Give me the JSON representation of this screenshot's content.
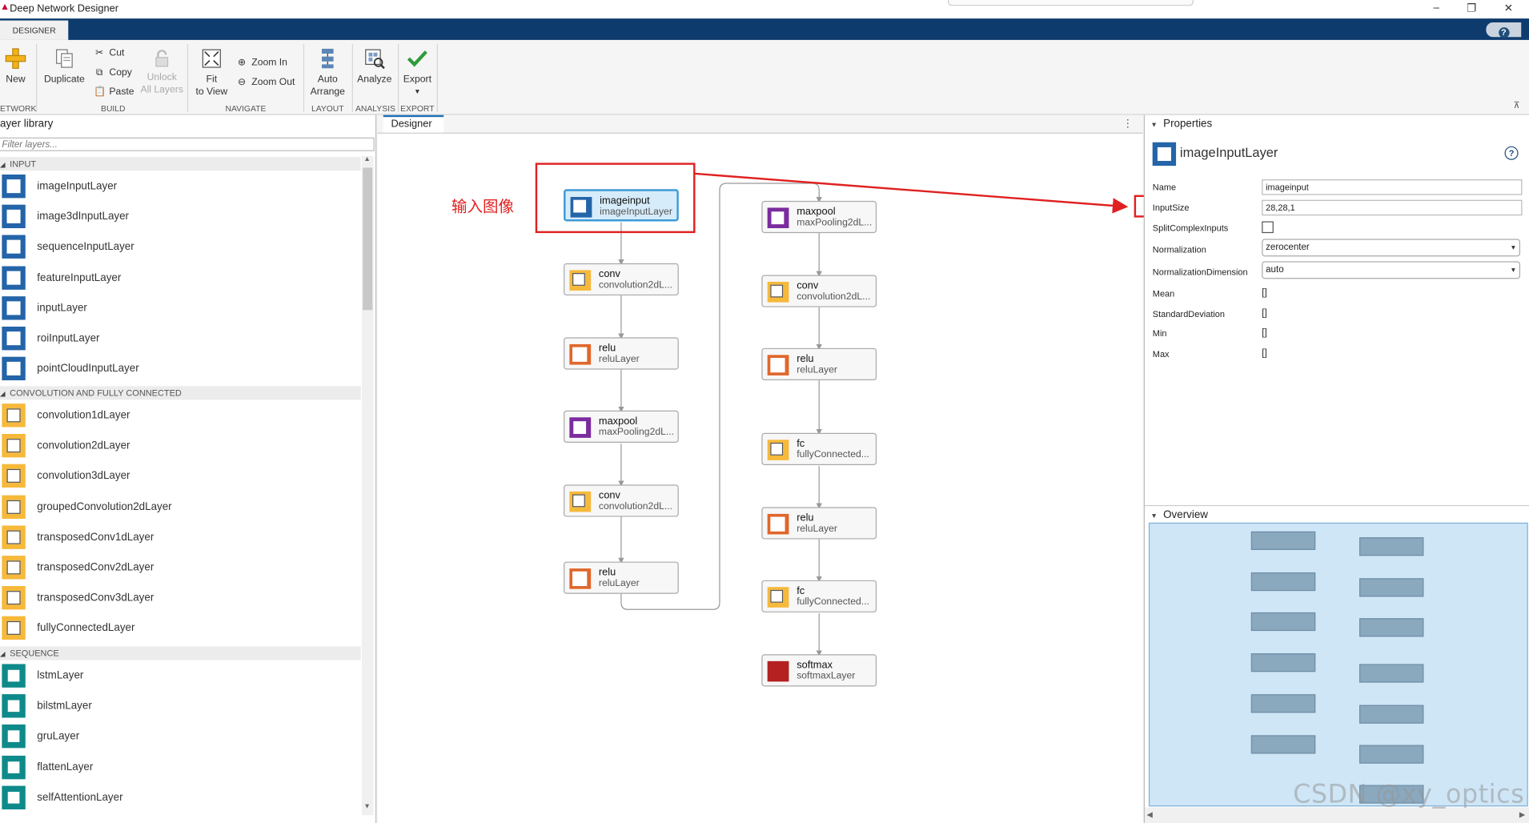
{
  "window": {
    "title": "Deep Network Designer",
    "min_glyph": "–",
    "max_glyph": "❐",
    "close_glyph": "✕"
  },
  "ribbon": {
    "tab": "DESIGNER",
    "help_glyph": "?"
  },
  "toolstrip": {
    "new_label": "New",
    "duplicate_label": "Duplicate",
    "cut_label": "Cut",
    "copy_label": "Copy",
    "paste_label": "Paste",
    "unlock_label": "Unlock",
    "unlock_label2": "All Layers",
    "fit_label": "Fit",
    "fit_label2": "to View",
    "zoom_in_label": "Zoom In",
    "zoom_out_label": "Zoom Out",
    "auto_label": "Auto",
    "auto_label2": "Arrange",
    "analyze_label": "Analyze",
    "export_label": "Export",
    "groups": {
      "network": "ETWORK",
      "build": "BUILD",
      "navigate": "NAVIGATE",
      "layout": "LAYOUT",
      "analysis": "ANALYSIS",
      "export": "EXPORT"
    }
  },
  "library": {
    "header": "ayer library",
    "filter_placeholder": "Filter layers...",
    "sections": {
      "input": "INPUT",
      "conv": "CONVOLUTION AND FULLY CONNECTED",
      "sequence": "SEQUENCE"
    },
    "input_items": [
      "imageInputLayer",
      "image3dInputLayer",
      "sequenceInputLayer",
      "featureInputLayer",
      "inputLayer",
      "roiInputLayer",
      "pointCloudInputLayer"
    ],
    "conv_items": [
      "convolution1dLayer",
      "convolution2dLayer",
      "convolution3dLayer",
      "groupedConvolution2dLayer",
      "transposedConv1dLayer",
      "transposedConv2dLayer",
      "transposedConv3dLayer",
      "fullyConnectedLayer"
    ],
    "sequence_items": [
      "lstmLayer",
      "bilstmLayer",
      "gruLayer",
      "flattenLayer",
      "selfAttentionLayer"
    ]
  },
  "designer": {
    "tab": "Designer",
    "more_glyph": "⋮",
    "annotation": "输入图像",
    "nodes": [
      {
        "name": "imageinput",
        "type": "imageInputLayer"
      },
      {
        "name": "conv",
        "type": "convolution2dL..."
      },
      {
        "name": "relu",
        "type": "reluLayer"
      },
      {
        "name": "maxpool",
        "type": "maxPooling2dL..."
      },
      {
        "name": "conv",
        "type": "convolution2dL..."
      },
      {
        "name": "relu",
        "type": "reluLayer"
      },
      {
        "name": "maxpool",
        "type": "maxPooling2dL..."
      },
      {
        "name": "conv",
        "type": "convolution2dL..."
      },
      {
        "name": "relu",
        "type": "reluLayer"
      },
      {
        "name": "fc",
        "type": "fullyConnected..."
      },
      {
        "name": "relu",
        "type": "reluLayer"
      },
      {
        "name": "fc",
        "type": "fullyConnected..."
      },
      {
        "name": "softmax",
        "type": "softmaxLayer"
      }
    ]
  },
  "properties": {
    "header": "Properties",
    "layer_title": "imageInputLayer",
    "help_glyph": "?",
    "name_label": "Name",
    "name_value": "imageinput",
    "inputsize_label": "InputSize",
    "inputsize_value": "28,28,1",
    "split_label": "SplitComplexInputs",
    "norm_label": "Normalization",
    "norm_value": "zerocenter",
    "normdim_label": "NormalizationDimension",
    "normdim_value": "auto",
    "mean_label": "Mean",
    "mean_value": "[]",
    "std_label": "StandardDeviation",
    "std_value": "[]",
    "min_label": "Min",
    "min_value": "[]",
    "max_label": "Max",
    "max_value": "[]"
  },
  "overview": {
    "header": "Overview"
  },
  "watermark": "CSDN @xy_optics",
  "colors": {
    "ribbon_bg": "#0d3b6e",
    "annotation_red": "#e02020",
    "selection_blue": "#3d9ad6"
  }
}
